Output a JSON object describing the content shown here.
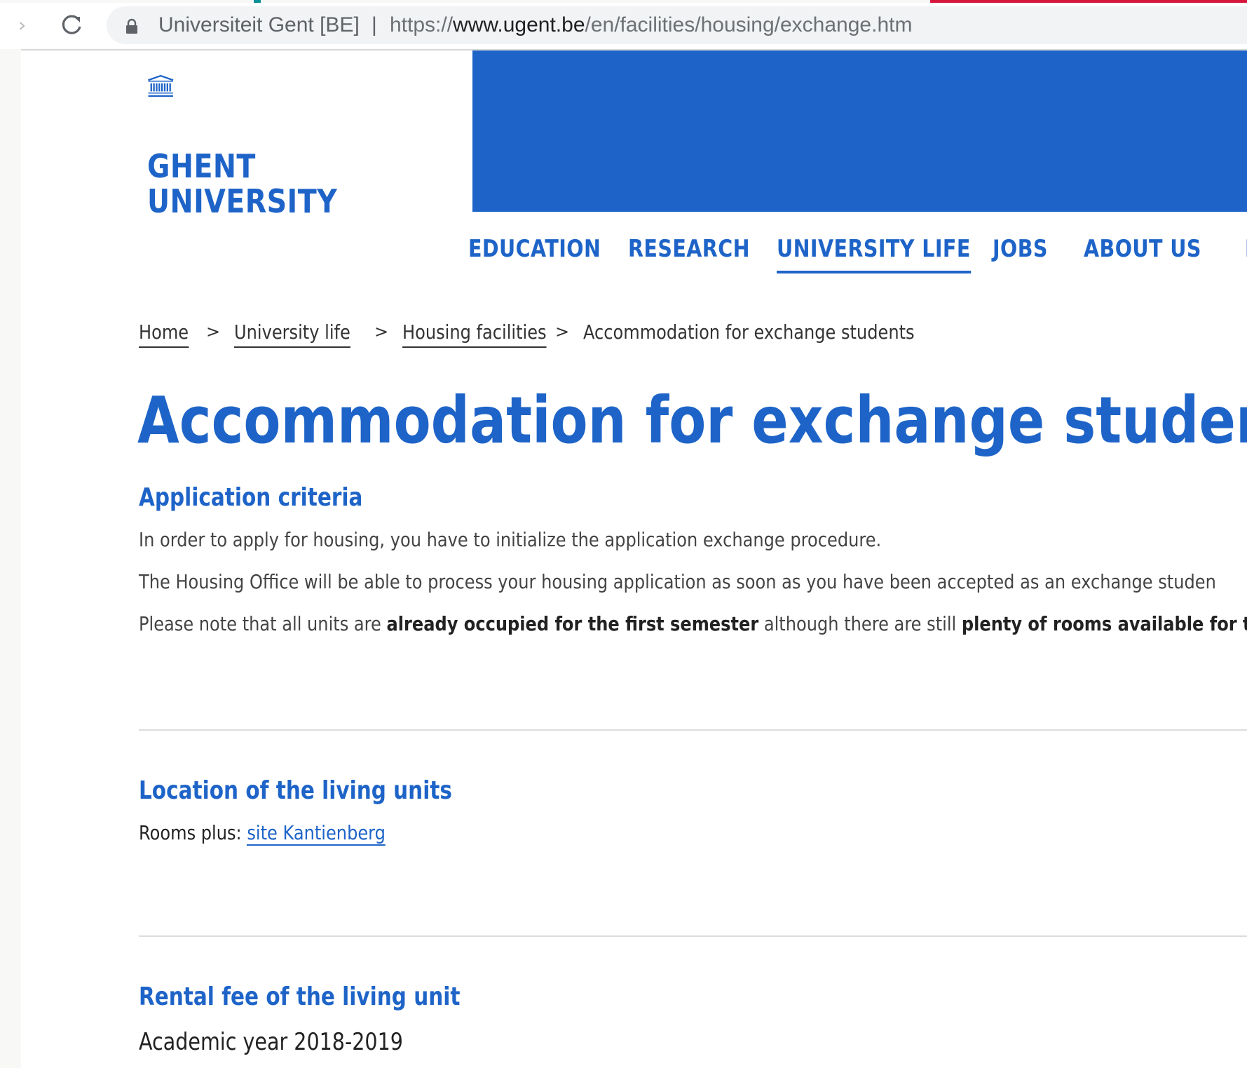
{
  "browser": {
    "forward_glyph": "›",
    "site_identity": "Universiteit Gent [BE]",
    "separator": "|",
    "url_scheme": "https://",
    "url_host": "www.ugent.be",
    "url_path": "/en/facilities/housing/exchange.htm"
  },
  "header": {
    "logo_line1": "GHENT",
    "logo_line2": "UNIVERSITY",
    "brand_color": "#1e64c8"
  },
  "nav": {
    "items": [
      {
        "label": "EDUCATION",
        "active": false
      },
      {
        "label": "RESEARCH",
        "active": false
      },
      {
        "label": "UNIVERSITY LIFE",
        "active": true
      },
      {
        "label": "JOBS",
        "active": false
      },
      {
        "label": "ABOUT US",
        "active": false
      },
      {
        "label": "IN",
        "active": false
      }
    ]
  },
  "breadcrumb": {
    "home": "Home",
    "university_life": "University life",
    "housing": "Housing facilities",
    "current": "Accommodation for exchange students",
    "separator": ">"
  },
  "main": {
    "title": "Accommodation for exchange students",
    "sections": {
      "criteria": {
        "heading": "Application criteria",
        "p1": "In order to apply for housing, you have to initialize the application exchange procedure.",
        "p2": "The Housing Office will be able to process your housing application as soon as you have been accepted as an exchange studen",
        "p3_a": "Please note that all units are ",
        "p3_b": "already occupied for the first semester",
        "p3_c": " although there are still ",
        "p3_d": "plenty of rooms available for t"
      },
      "location": {
        "heading": "Location of the living units",
        "rooms_label": "Rooms plus",
        "colon": ": ",
        "rooms_link": "site Kantienberg"
      },
      "rental": {
        "heading": "Rental fee of the living unit",
        "year": "Academic year 2018-2019"
      }
    }
  }
}
